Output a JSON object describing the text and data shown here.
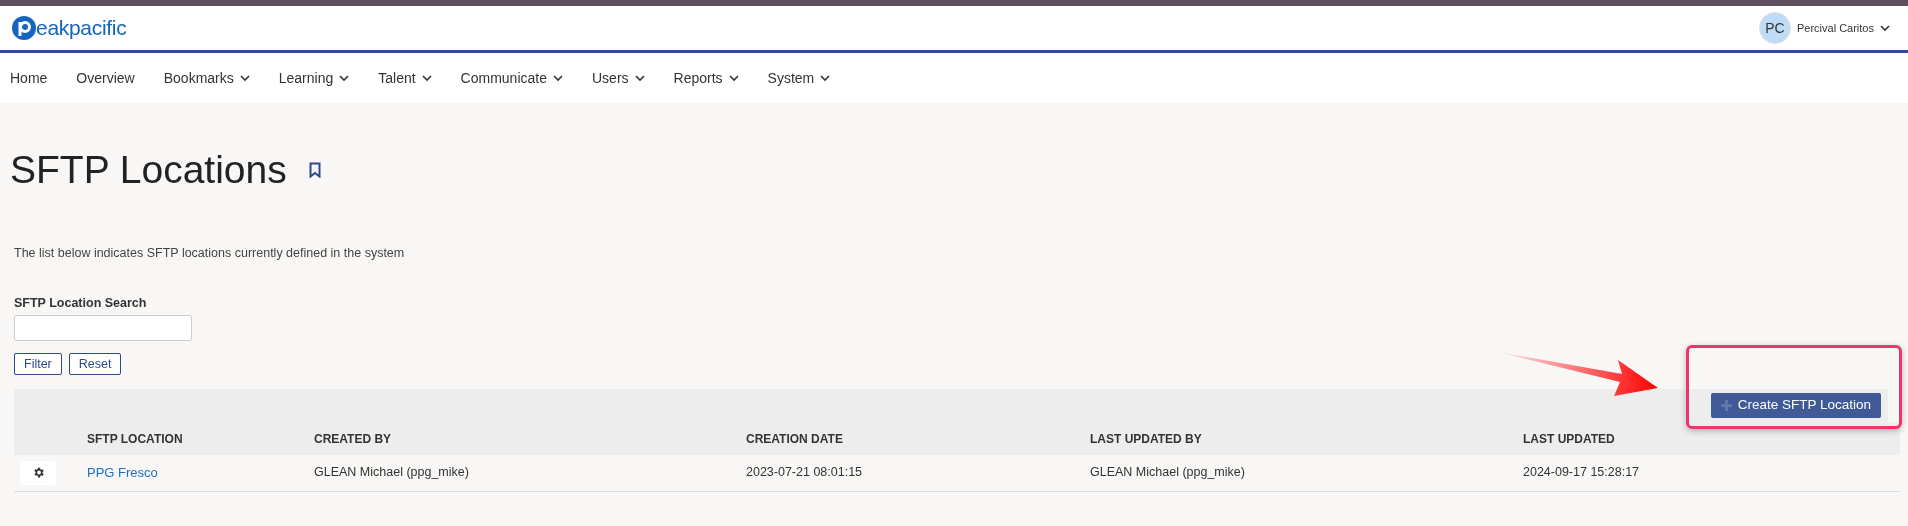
{
  "logo": {
    "text": "eakpacific"
  },
  "user": {
    "initials": "PC",
    "name": "Percival Caritos"
  },
  "nav": [
    {
      "label": "Home",
      "dropdown": false
    },
    {
      "label": "Overview",
      "dropdown": false
    },
    {
      "label": "Bookmarks",
      "dropdown": true
    },
    {
      "label": "Learning",
      "dropdown": true
    },
    {
      "label": "Talent",
      "dropdown": true
    },
    {
      "label": "Communicate",
      "dropdown": true
    },
    {
      "label": "Users",
      "dropdown": true
    },
    {
      "label": "Reports",
      "dropdown": true
    },
    {
      "label": "System",
      "dropdown": true
    }
  ],
  "page": {
    "title": "SFTP Locations",
    "description": "The list below indicates SFTP locations currently defined in the system"
  },
  "search": {
    "label": "SFTP Location Search",
    "buttons": [
      "Filter",
      "Reset"
    ]
  },
  "create_button": {
    "label": "Create SFTP Location"
  },
  "table": {
    "columns": [
      "SFTP LOCATION",
      "CREATED BY",
      "CREATION DATE",
      "LAST UPDATED BY",
      "LAST UPDATED"
    ],
    "rows": [
      {
        "cells": [
          "PPG Fresco",
          "GLEAN Michael (ppg_mike)",
          "2023-07-21 08:01:15",
          "GLEAN Michael (ppg_mike)",
          "2024-09-17 15:28:17"
        ]
      }
    ]
  }
}
